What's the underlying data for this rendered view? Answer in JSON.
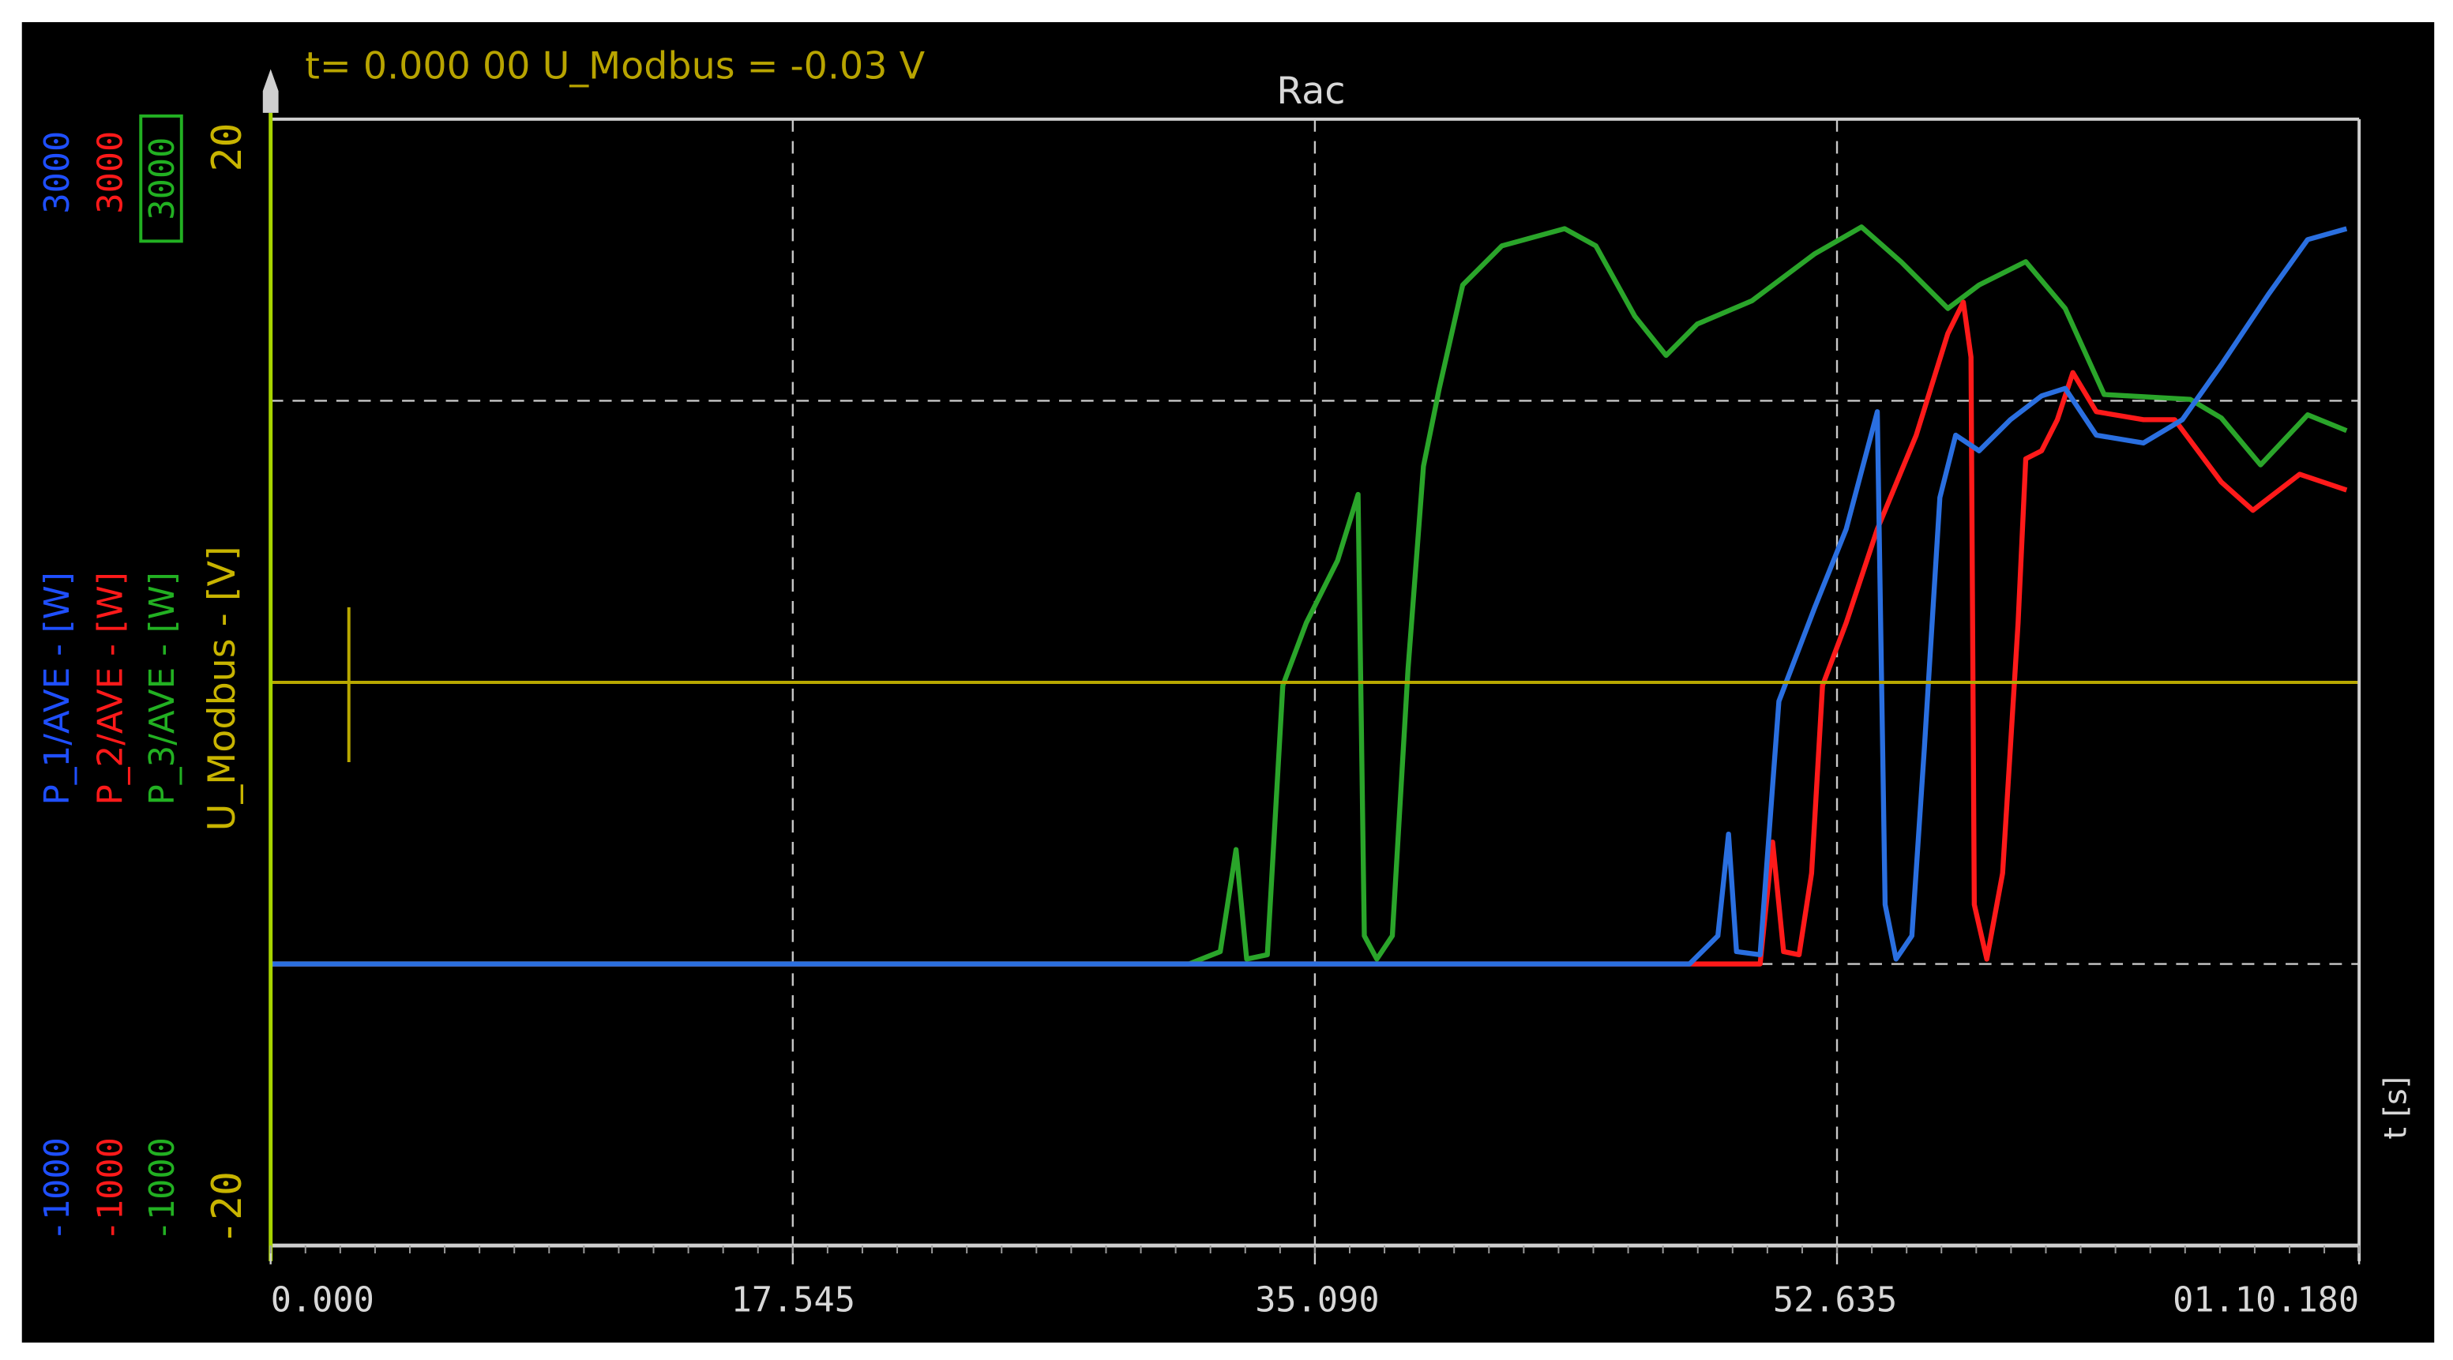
{
  "chart_data": {
    "type": "line",
    "title": "Rac",
    "cursor_readout": "t= 0.000 00  U_Modbus = -0.03 V",
    "xlabel": "t [s]",
    "xlim": [
      0,
      70.18
    ],
    "x_ticks": [
      0,
      17.545,
      35.09,
      52.635,
      70.18
    ],
    "x_tick_labels": [
      "0.000",
      "17.545",
      "35.090",
      "52.635",
      "01.10.180"
    ],
    "grid": true,
    "axes": [
      {
        "name": "P_1/AVE - [W]",
        "color": "#1f4fff",
        "top": "3000",
        "bottom": "-1000",
        "ylim": [
          -1000,
          3000
        ]
      },
      {
        "name": "P_2/AVE - [W]",
        "color": "#ff1a1a",
        "top": "3000",
        "bottom": "-1000",
        "ylim": [
          -1000,
          3000
        ]
      },
      {
        "name": "P_3/AVE - [W]",
        "color": "#22b022",
        "top": "3000",
        "bottom": "-1000",
        "ylim": [
          -1000,
          3000
        ]
      },
      {
        "name": "U_Modbus - [V]",
        "color": "#c8b400",
        "top": "20",
        "bottom": "-20",
        "ylim": [
          -20,
          20
        ]
      }
    ],
    "series": [
      {
        "name": "P_3/AVE",
        "color": "#2aa52a",
        "axis": 2,
        "t": [
          0,
          30.86,
          31.91,
          32.44,
          32.8,
          33.49,
          34.01,
          34.8,
          35.85,
          36.54,
          36.75,
          37.17,
          37.69,
          38.22,
          38.74,
          39.27,
          40.06,
          41.37,
          43.48,
          44.53,
          45.84,
          46.89,
          47.94,
          49.78,
          51.89,
          53.46,
          54.78,
          56.36,
          57.41,
          58.98,
          60.3,
          61.61,
          64.5,
          65.55,
          66.87,
          68.45,
          69.76
        ],
        "values": [
          0,
          0,
          44,
          406,
          17,
          33,
          989,
          1211,
          1433,
          1667,
          100,
          17,
          100,
          1044,
          1767,
          2044,
          2411,
          2550,
          2611,
          2550,
          2300,
          2161,
          2272,
          2355,
          2522,
          2617,
          2494,
          2328,
          2411,
          2494,
          2328,
          2022,
          2005,
          1939,
          1772,
          1950,
          1894
        ]
      },
      {
        "name": "P_2/AVE",
        "color": "#ff1a1a",
        "axis": 1,
        "t": [
          0,
          50.05,
          50.47,
          50.84,
          51.36,
          51.78,
          52.15,
          52.94,
          53.99,
          55.3,
          56.36,
          56.88,
          57.14,
          57.25,
          57.67,
          58.2,
          58.72,
          58.98,
          59.51,
          60.04,
          60.56,
          61.35,
          62.93,
          63.98,
          65.55,
          66.61,
          68.18,
          69.76
        ],
        "values": [
          0,
          0,
          433,
          44,
          33,
          322,
          989,
          1211,
          1544,
          1878,
          2239,
          2350,
          2155,
          211,
          17,
          322,
          1211,
          1794,
          1822,
          1933,
          2100,
          1961,
          1933,
          1933,
          1711,
          1611,
          1739,
          1683
        ]
      },
      {
        "name": "P_1/AVE",
        "color": "#2a6fe0",
        "axis": 0,
        "t": [
          0,
          47.68,
          48.63,
          48.99,
          49.26,
          50.05,
          50.41,
          50.68,
          51.89,
          52.94,
          53.99,
          54.25,
          54.62,
          55.15,
          55.57,
          56.09,
          56.62,
          57.41,
          58.46,
          59.51,
          60.3,
          61.35,
          62.93,
          64.24,
          65.55,
          67.13,
          68.45,
          69.76
        ],
        "values": [
          0,
          0,
          100,
          461,
          44,
          33,
          544,
          933,
          1267,
          1544,
          1961,
          211,
          17,
          100,
          767,
          1656,
          1878,
          1822,
          1933,
          2017,
          2044,
          1878,
          1850,
          1933,
          2128,
          2378,
          2572,
          2611
        ]
      },
      {
        "name": "U_Modbus",
        "color": "#b8a800",
        "axis": 3,
        "t": [
          0,
          70.18
        ],
        "values": [
          0,
          0
        ]
      }
    ]
  }
}
